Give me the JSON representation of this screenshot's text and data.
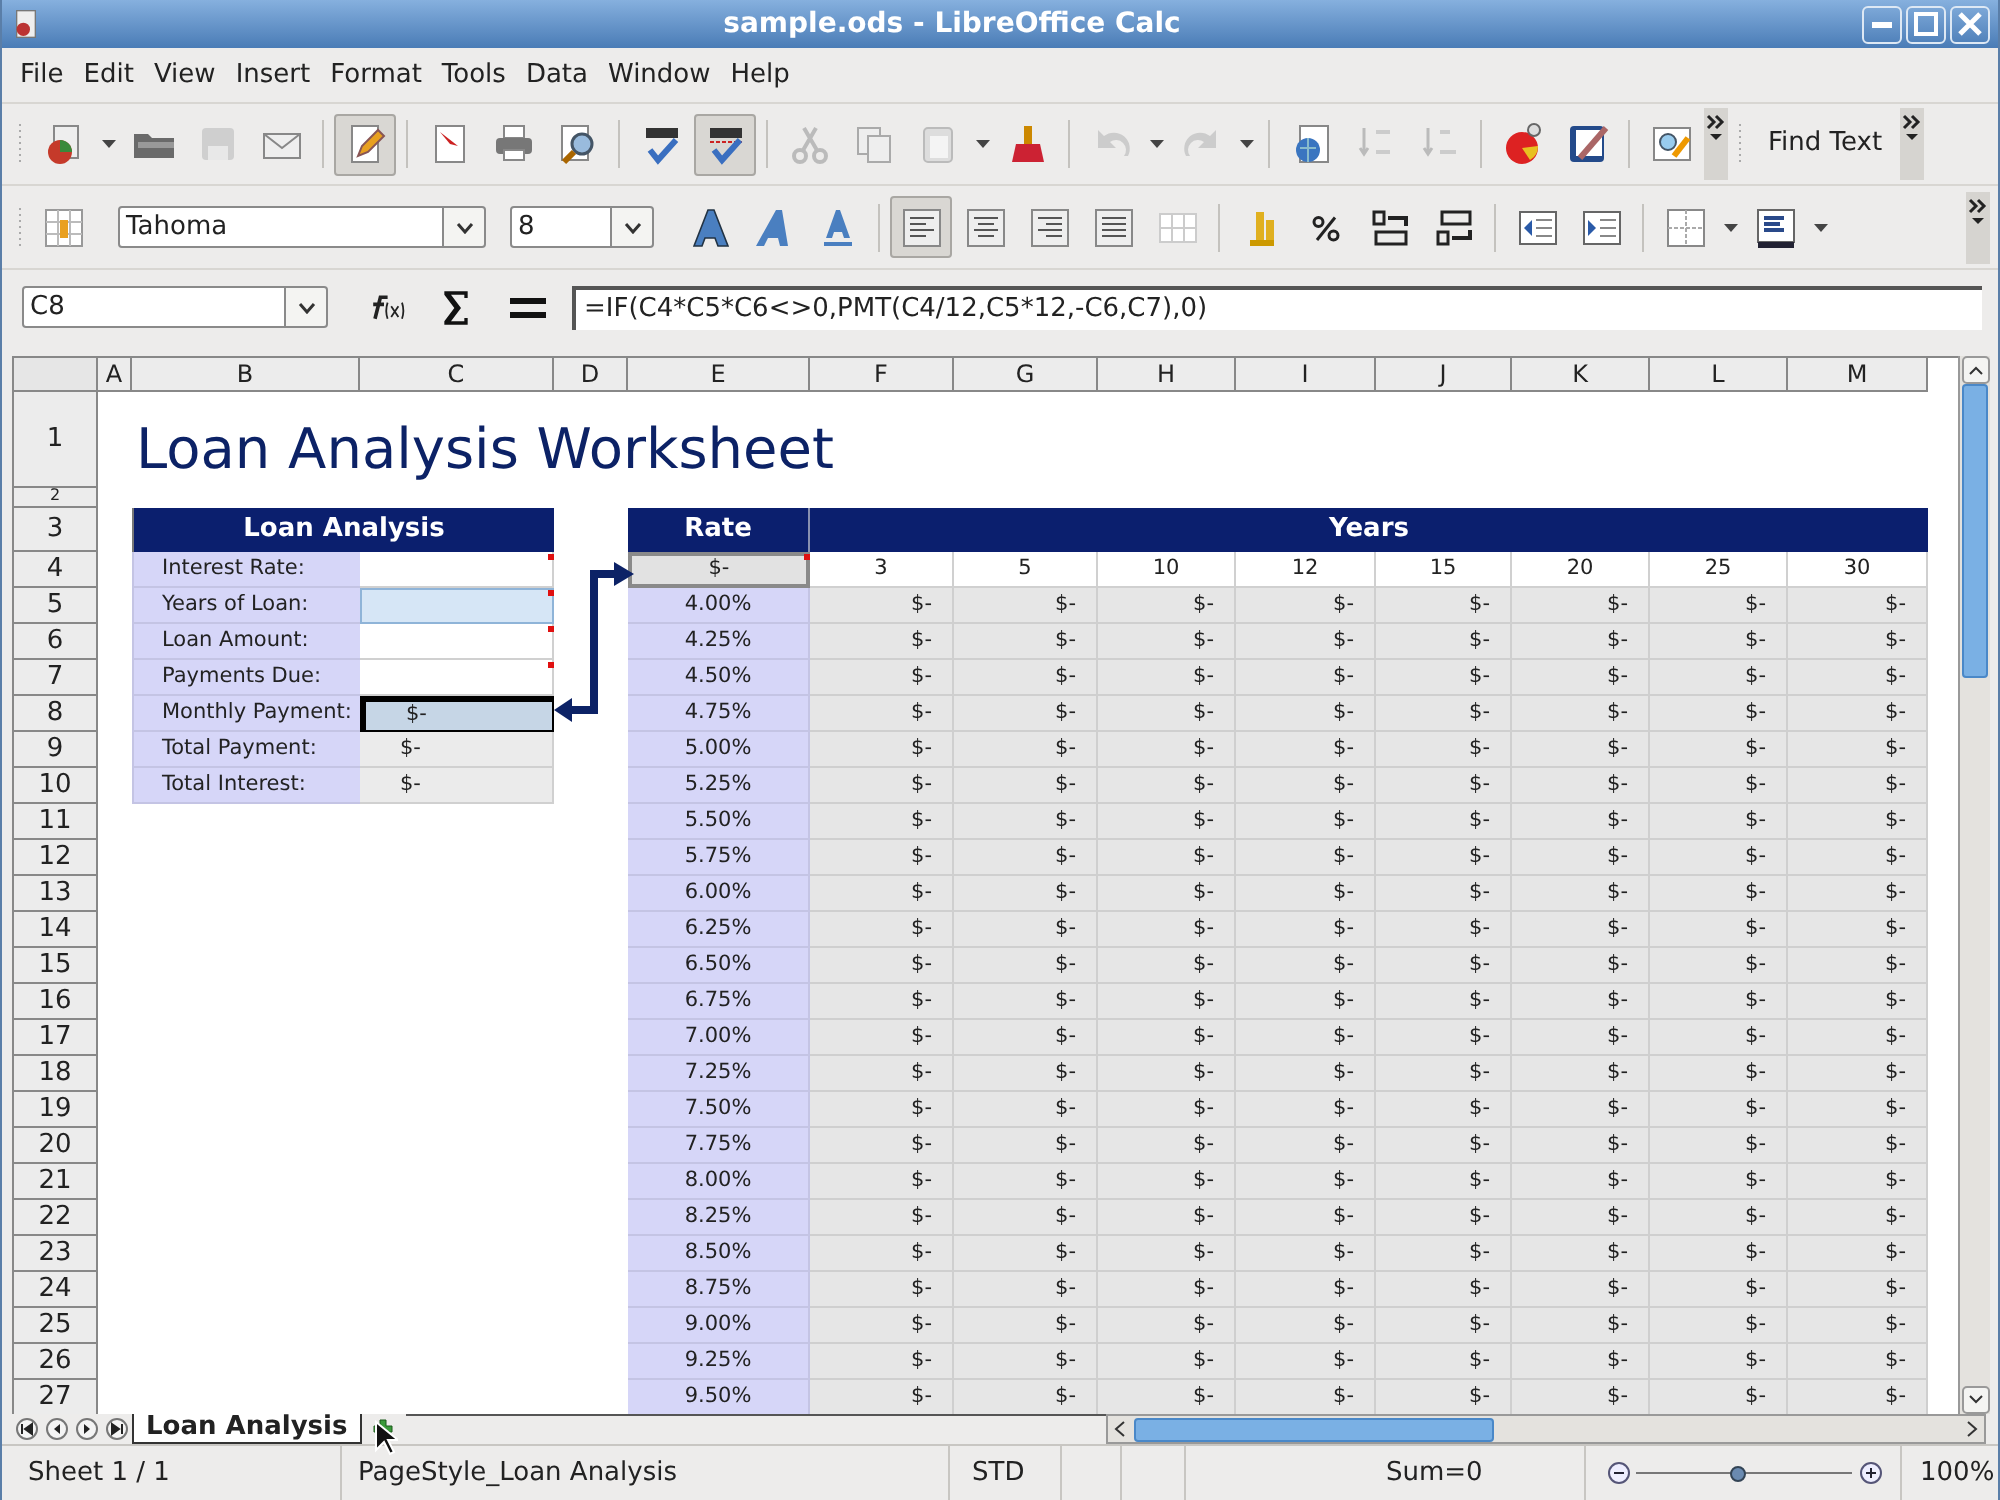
{
  "window": {
    "title": "sample.ods - LibreOffice Calc"
  },
  "menu": [
    "File",
    "Edit",
    "View",
    "Insert",
    "Format",
    "Tools",
    "Data",
    "Window",
    "Help"
  ],
  "standard_toolbar": {
    "edit_file_on": true,
    "autospellcheck_on": true,
    "find_text": "Find Text"
  },
  "formatting_toolbar": {
    "font": "Tahoma",
    "size": "8",
    "align_left_on": true
  },
  "formula_bar": {
    "name_box": "C8",
    "formula": "=IF(C4*C5*C6<>0,PMT(C4/12,C5*12,-C6,C7),0)"
  },
  "columns": [
    "A",
    "B",
    "C",
    "D",
    "E",
    "F",
    "G",
    "H",
    "I",
    "J",
    "K",
    "L",
    "M"
  ],
  "row_headers": [
    "1",
    "2",
    "3",
    "4",
    "5",
    "6",
    "7",
    "8",
    "9",
    "10",
    "11",
    "12",
    "13",
    "14",
    "15",
    "16",
    "17",
    "18",
    "19",
    "20",
    "21",
    "22",
    "23",
    "24",
    "25",
    "26",
    "27"
  ],
  "sheet_title": "Loan Analysis Worksheet",
  "loan_analysis": {
    "header": "Loan Analysis",
    "fields": [
      {
        "label": "Interest Rate:",
        "kind": "input",
        "has_comment": true,
        "highlighted": false,
        "selected": false
      },
      {
        "label": "Years of Loan:",
        "kind": "input",
        "has_comment": true,
        "highlighted": true,
        "selected": false
      },
      {
        "label": "Loan Amount:",
        "kind": "input",
        "has_comment": true,
        "highlighted": false,
        "selected": false
      },
      {
        "label": "Payments Due:",
        "kind": "input",
        "has_comment": true,
        "highlighted": false,
        "selected": false
      },
      {
        "label": "Monthly Payment:",
        "kind": "output",
        "value": "$-",
        "has_comment": false,
        "highlighted": false,
        "selected": true
      },
      {
        "label": "Total Payment:",
        "kind": "output",
        "value": "$-",
        "has_comment": false,
        "highlighted": false,
        "selected": false
      },
      {
        "label": "Total Interest:",
        "kind": "output",
        "value": "$-",
        "has_comment": false,
        "highlighted": false,
        "selected": false
      }
    ]
  },
  "rate_table": {
    "rate_header": "Rate",
    "years_header": "Years",
    "corner": {
      "value": "$-",
      "has_comment": true
    },
    "years": [
      "3",
      "5",
      "10",
      "12",
      "15",
      "20",
      "25",
      "30"
    ],
    "rows": [
      {
        "rate": "4.00%",
        "values": [
          "$-",
          "$-",
          "$-",
          "$-",
          "$-",
          "$-",
          "$-",
          "$-"
        ]
      },
      {
        "rate": "4.25%",
        "values": [
          "$-",
          "$-",
          "$-",
          "$-",
          "$-",
          "$-",
          "$-",
          "$-"
        ]
      },
      {
        "rate": "4.50%",
        "values": [
          "$-",
          "$-",
          "$-",
          "$-",
          "$-",
          "$-",
          "$-",
          "$-"
        ]
      },
      {
        "rate": "4.75%",
        "values": [
          "$-",
          "$-",
          "$-",
          "$-",
          "$-",
          "$-",
          "$-",
          "$-"
        ]
      },
      {
        "rate": "5.00%",
        "values": [
          "$-",
          "$-",
          "$-",
          "$-",
          "$-",
          "$-",
          "$-",
          "$-"
        ]
      },
      {
        "rate": "5.25%",
        "values": [
          "$-",
          "$-",
          "$-",
          "$-",
          "$-",
          "$-",
          "$-",
          "$-"
        ]
      },
      {
        "rate": "5.50%",
        "values": [
          "$-",
          "$-",
          "$-",
          "$-",
          "$-",
          "$-",
          "$-",
          "$-"
        ]
      },
      {
        "rate": "5.75%",
        "values": [
          "$-",
          "$-",
          "$-",
          "$-",
          "$-",
          "$-",
          "$-",
          "$-"
        ]
      },
      {
        "rate": "6.00%",
        "values": [
          "$-",
          "$-",
          "$-",
          "$-",
          "$-",
          "$-",
          "$-",
          "$-"
        ]
      },
      {
        "rate": "6.25%",
        "values": [
          "$-",
          "$-",
          "$-",
          "$-",
          "$-",
          "$-",
          "$-",
          "$-"
        ]
      },
      {
        "rate": "6.50%",
        "values": [
          "$-",
          "$-",
          "$-",
          "$-",
          "$-",
          "$-",
          "$-",
          "$-"
        ]
      },
      {
        "rate": "6.75%",
        "values": [
          "$-",
          "$-",
          "$-",
          "$-",
          "$-",
          "$-",
          "$-",
          "$-"
        ]
      },
      {
        "rate": "7.00%",
        "values": [
          "$-",
          "$-",
          "$-",
          "$-",
          "$-",
          "$-",
          "$-",
          "$-"
        ]
      },
      {
        "rate": "7.25%",
        "values": [
          "$-",
          "$-",
          "$-",
          "$-",
          "$-",
          "$-",
          "$-",
          "$-"
        ]
      },
      {
        "rate": "7.50%",
        "values": [
          "$-",
          "$-",
          "$-",
          "$-",
          "$-",
          "$-",
          "$-",
          "$-"
        ]
      },
      {
        "rate": "7.75%",
        "values": [
          "$-",
          "$-",
          "$-",
          "$-",
          "$-",
          "$-",
          "$-",
          "$-"
        ]
      },
      {
        "rate": "8.00%",
        "values": [
          "$-",
          "$-",
          "$-",
          "$-",
          "$-",
          "$-",
          "$-",
          "$-"
        ]
      },
      {
        "rate": "8.25%",
        "values": [
          "$-",
          "$-",
          "$-",
          "$-",
          "$-",
          "$-",
          "$-",
          "$-"
        ]
      },
      {
        "rate": "8.50%",
        "values": [
          "$-",
          "$-",
          "$-",
          "$-",
          "$-",
          "$-",
          "$-",
          "$-"
        ]
      },
      {
        "rate": "8.75%",
        "values": [
          "$-",
          "$-",
          "$-",
          "$-",
          "$-",
          "$-",
          "$-",
          "$-"
        ]
      },
      {
        "rate": "9.00%",
        "values": [
          "$-",
          "$-",
          "$-",
          "$-",
          "$-",
          "$-",
          "$-",
          "$-"
        ]
      },
      {
        "rate": "9.25%",
        "values": [
          "$-",
          "$-",
          "$-",
          "$-",
          "$-",
          "$-",
          "$-",
          "$-"
        ]
      },
      {
        "rate": "9.50%",
        "values": [
          "$-",
          "$-",
          "$-",
          "$-",
          "$-",
          "$-",
          "$-",
          "$-"
        ]
      }
    ]
  },
  "sheet_tabs": [
    {
      "label": "Loan Analysis",
      "selected": true
    }
  ],
  "status_bar": {
    "sheet": "Sheet 1 / 1",
    "page_style": "PageStyle_Loan Analysis",
    "mode": "STD",
    "sum": "Sum=0",
    "zoom_slider": {
      "level": 0.47
    },
    "zoom": "100%"
  }
}
